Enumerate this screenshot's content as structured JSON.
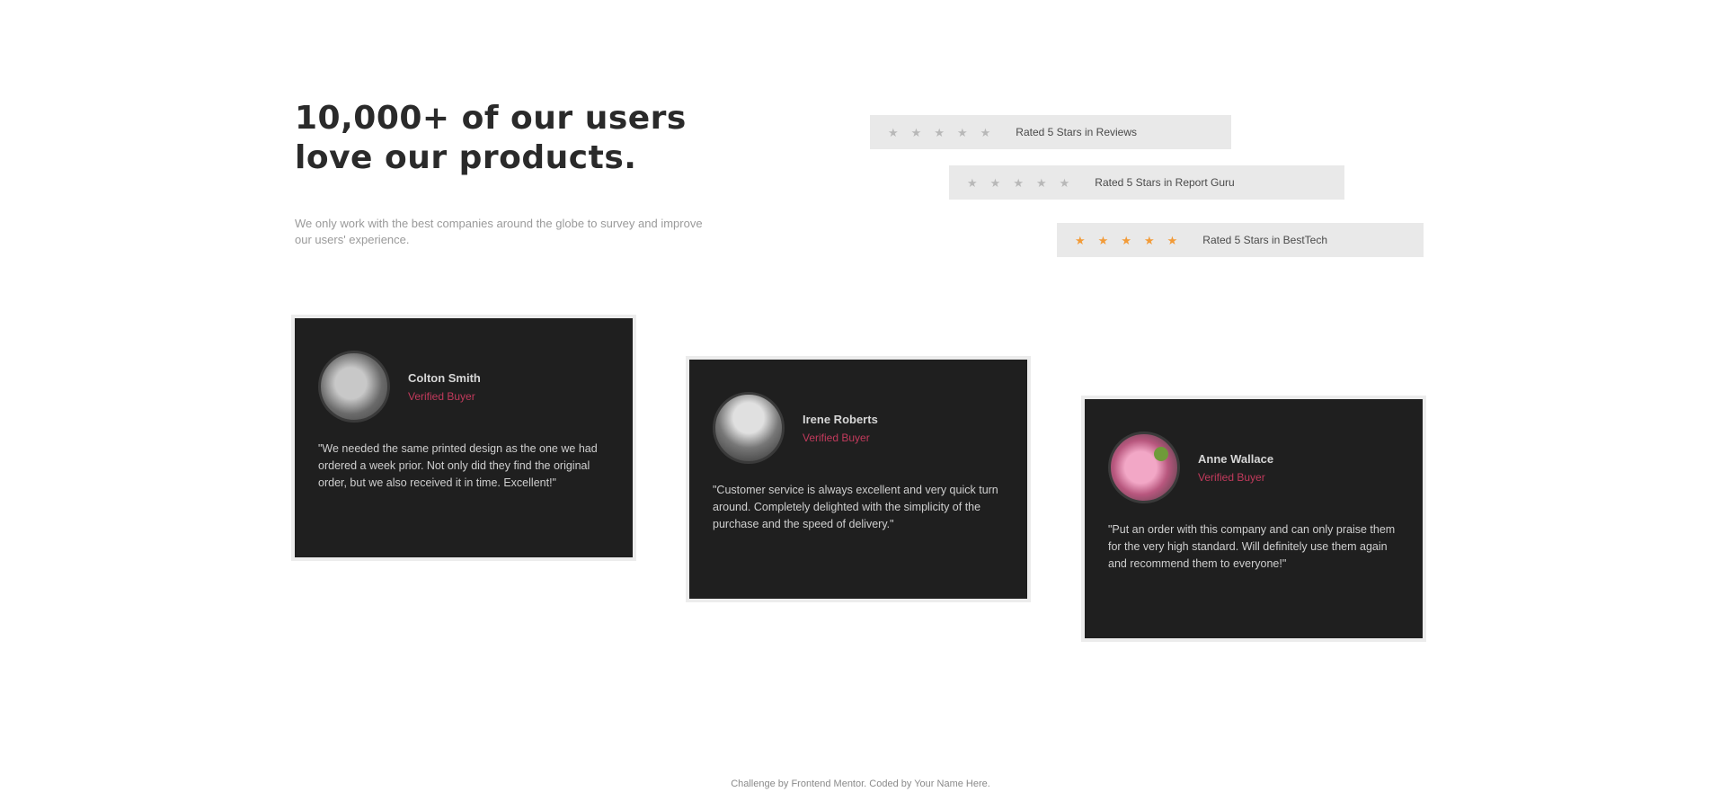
{
  "heading": {
    "title_line1": "10,000+ of our users",
    "title_line2": "love our products.",
    "subtitle": "We only work with the best companies around the globe to survey and improve our users' experience."
  },
  "ratings": [
    {
      "stars": 5,
      "star_color": "#b8b8b8",
      "text": "Rated 5 Stars in Reviews"
    },
    {
      "stars": 5,
      "star_color": "#b8b8b8",
      "text": "Rated 5 Stars in Report Guru"
    },
    {
      "stars": 5,
      "star_color": "#f29b38",
      "text": "Rated 5 Stars in BestTech"
    }
  ],
  "testimonials": [
    {
      "name": "Colton Smith",
      "role": "Verified Buyer",
      "quote": "\"We needed the same printed design as the one we had ordered a week prior. Not only did they find the original order, but we also received it in time. Excellent!\""
    },
    {
      "name": "Irene Roberts",
      "role": "Verified Buyer",
      "quote": "\"Customer service is always excellent and very quick turn around. Completely delighted with the simplicity of the purchase and the speed of delivery.\""
    },
    {
      "name": "Anne Wallace",
      "role": "Verified Buyer",
      "quote": "\"Put an order with this company and can only praise them for the very high standard. Will definitely use them again and recommend them to everyone!\""
    }
  ],
  "footer": {
    "text": "Challenge by Frontend Mentor. Coded by Your Name Here."
  },
  "colors": {
    "card_bg": "#1f1f1f",
    "accent": "#c23a5c",
    "star_gold": "#f29b38"
  }
}
